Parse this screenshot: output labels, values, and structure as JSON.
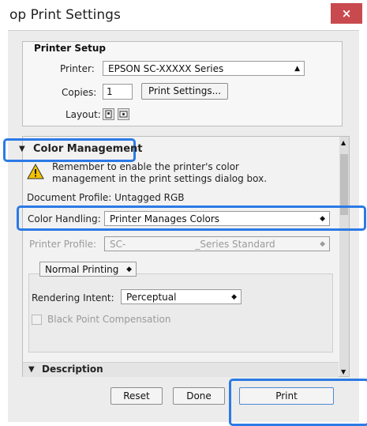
{
  "window": {
    "title": "op Print Settings",
    "close_glyph": "×"
  },
  "printer_setup": {
    "section_title": "Printer Setup",
    "printer_label": "Printer:",
    "printer_value": "EPSON SC-XXXXX Series",
    "copies_label": "Copies:",
    "copies_value": "1",
    "print_settings_button": "Print Settings...",
    "layout_label": "Layout:"
  },
  "color_management": {
    "section_title": "Color Management",
    "expand_glyph": "▼",
    "warning_line1": "Remember to enable the printer's color",
    "warning_line2": "management in the print settings dialog box.",
    "document_profile": "Document Profile: Untagged RGB",
    "color_handling_label": "Color Handling:",
    "color_handling_value": "Printer Manages Colors",
    "printer_profile_label": "Printer Profile:",
    "printer_profile_value": "SC-",
    "printer_profile_suffix": "_Series Standard",
    "printing_mode": "Normal Printing",
    "rendering_intent_label": "Rendering Intent:",
    "rendering_intent_value": "Perceptual",
    "black_point_label": "Black Point Compensation"
  },
  "description": {
    "section_title": "Description",
    "expand_glyph": "▼"
  },
  "footer": {
    "reset_button": "Reset",
    "done_button": "Done",
    "print_button": "Print"
  },
  "colors": {
    "highlight": "#2b7ae5",
    "close_button": "#c84a4f",
    "warning_icon": "#f2c200"
  },
  "icons": [
    "close-icon",
    "warning-icon",
    "chevron-updown-icon",
    "layout-portrait-icon",
    "layout-landscape-icon",
    "expand-triangle-icon"
  ]
}
